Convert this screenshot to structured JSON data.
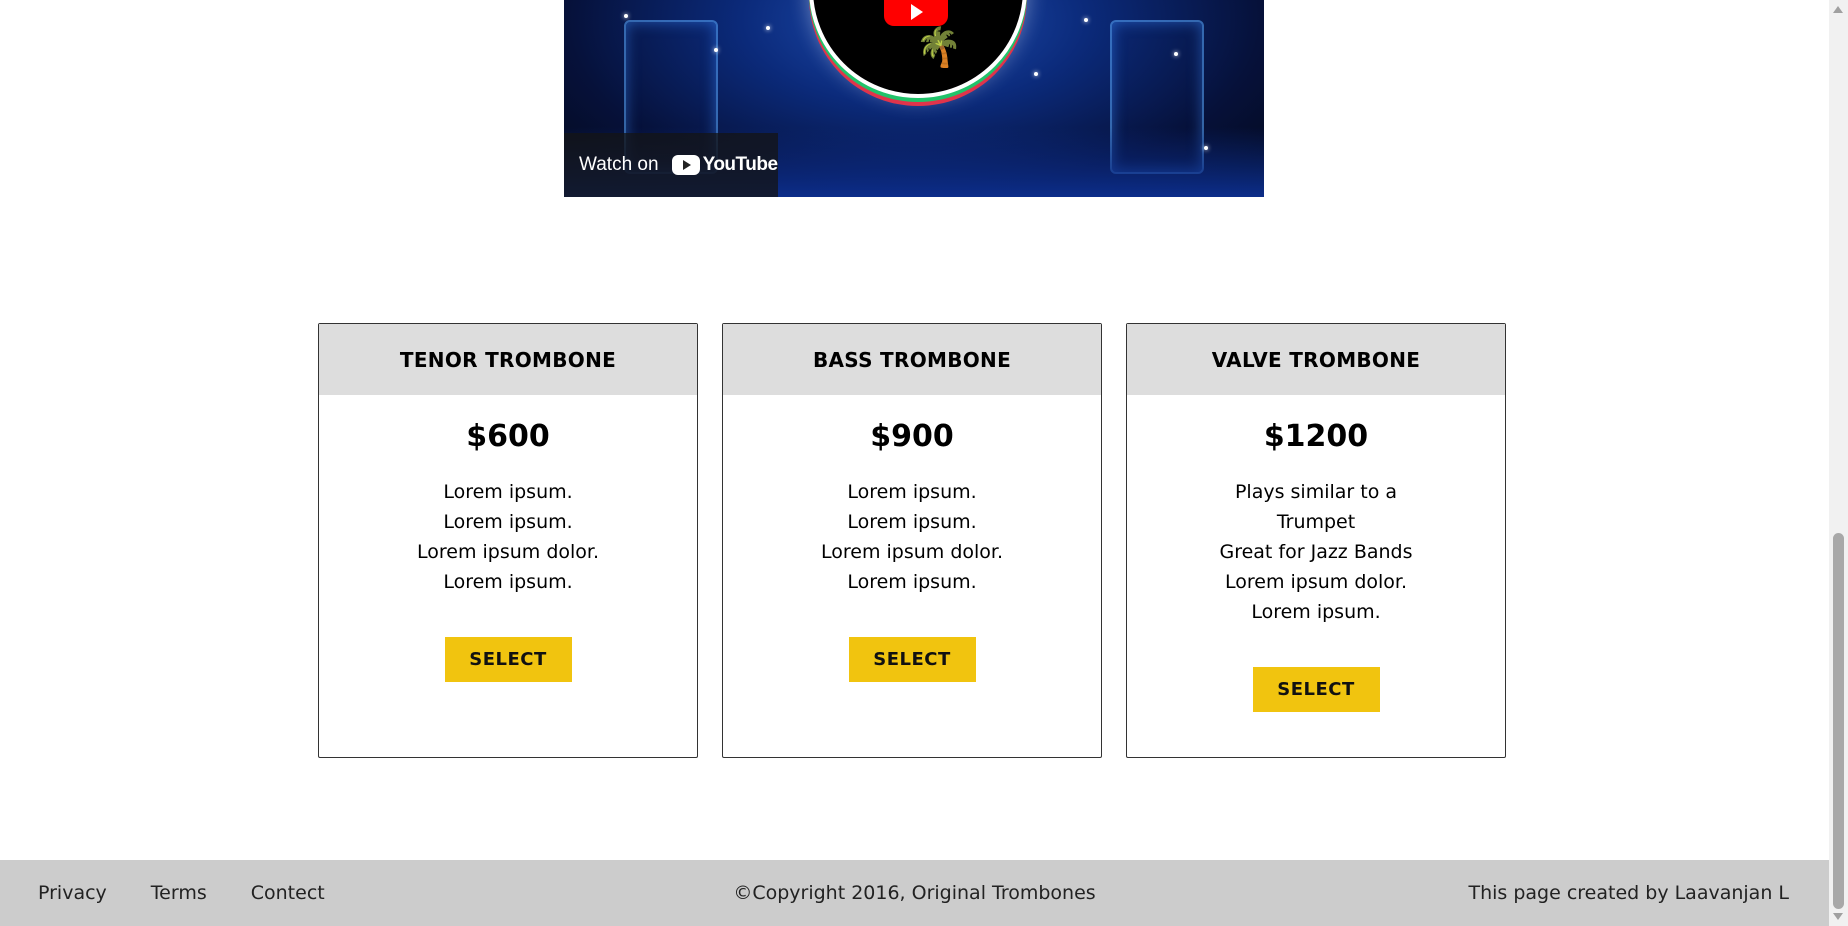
{
  "video": {
    "watch_label": "Watch on",
    "brand": "YouTube"
  },
  "plans": [
    {
      "name": "TENOR TROMBONE",
      "price": "$600",
      "features": [
        "Lorem ipsum.",
        "Lorem ipsum.",
        "Lorem ipsum dolor.",
        "Lorem ipsum."
      ],
      "button": "SELECT"
    },
    {
      "name": "BASS TROMBONE",
      "price": "$900",
      "features": [
        "Lorem ipsum.",
        "Lorem ipsum.",
        "Lorem ipsum dolor.",
        "Lorem ipsum."
      ],
      "button": "SELECT"
    },
    {
      "name": "VALVE TROMBONE",
      "price": "$1200",
      "features": [
        "Plays similar to a",
        "Trumpet",
        "Great for Jazz Bands",
        "Lorem ipsum dolor.",
        "Lorem ipsum."
      ],
      "button": "SELECT"
    }
  ],
  "footer": {
    "links": [
      "Privacy",
      "Terms",
      "Contect"
    ],
    "copyright": "©Copyright 2016, Original Trombones",
    "credit": "This page created by Laavanjan L"
  },
  "colors": {
    "select_button": "#f1c40f",
    "card_header": "#dddddd",
    "footer_bg": "#cccccc"
  }
}
